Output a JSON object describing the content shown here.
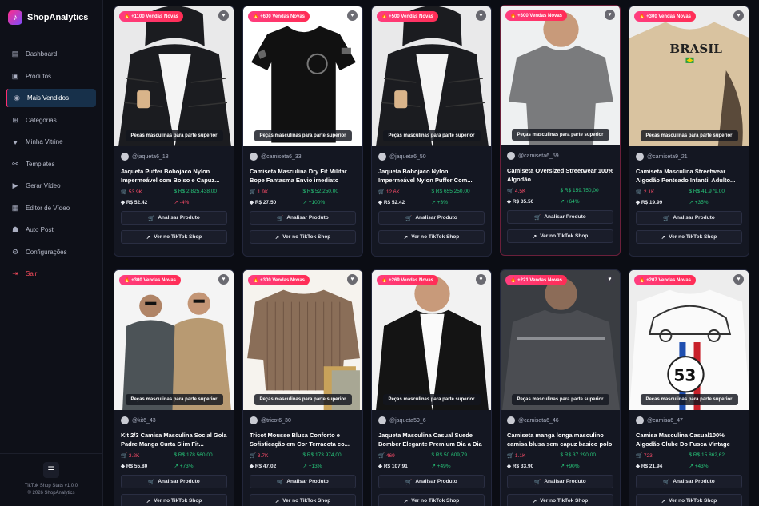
{
  "brand": {
    "name": "ShopAnalytics"
  },
  "nav": [
    {
      "label": "Dashboard",
      "icon": "chart-line-icon",
      "glyph": "▤"
    },
    {
      "label": "Produtos",
      "icon": "bag-icon",
      "glyph": "▣"
    },
    {
      "label": "Mais Vendidos",
      "icon": "flame-icon",
      "glyph": "◉"
    },
    {
      "label": "Categorias",
      "icon": "grid-icon",
      "glyph": "⊞"
    },
    {
      "label": "Minha Vitrine",
      "icon": "heart-icon",
      "glyph": "♥"
    },
    {
      "label": "Templates",
      "icon": "link-icon",
      "glyph": "⚯"
    },
    {
      "label": "Gerar Vídeo",
      "icon": "video-icon",
      "glyph": "▶"
    },
    {
      "label": "Editor de Vídeo",
      "icon": "film-icon",
      "glyph": "▦"
    },
    {
      "label": "Auto Post",
      "icon": "robot-icon",
      "glyph": "☗"
    },
    {
      "label": "Configurações",
      "icon": "gear-icon",
      "glyph": "⚙"
    },
    {
      "label": "Sair",
      "icon": "logout-icon",
      "glyph": "⇥"
    }
  ],
  "footer": {
    "version": "TikTok Shop Stats v1.0.0",
    "copyright": "© 2026 ShopAnalytics"
  },
  "card_common": {
    "category": "Peças masculinas para parte superior",
    "analyze": "Analisar Produto",
    "tiktok": "Ver no TikTok Shop"
  },
  "products": [
    {
      "badge": "🔥 +1100 Vendas Novas",
      "user": "@jaqueta6_18",
      "title": "Jaqueta Puffer Bobojaco Nylon Impermeável com Bolso e Capuz...",
      "sold": "53.9K",
      "revenue": "R$ 2.825.438,00",
      "price": "R$ 52.42",
      "growth": "-4%",
      "negative": true,
      "art": "puffer"
    },
    {
      "badge": "🔥 +600 Vendas Novas",
      "user": "@camiseta6_33",
      "title": "Camiseta Masculina Dry Fit Militar Bope Fantasma Envio imediato",
      "sold": "1.9K",
      "revenue": "R$ 52.250,00",
      "price": "R$ 27.50",
      "growth": "+100%",
      "negative": false,
      "art": "tshirt"
    },
    {
      "badge": "🔥 +500 Vendas Novas",
      "user": "@jaqueta6_50",
      "title": "Jaqueta Bobojaco Nylon Impermeável Nylon Puffer Com...",
      "sold": "12.6K",
      "revenue": "R$ 655.250,00",
      "price": "R$ 52.42",
      "growth": "+3%",
      "negative": false,
      "art": "puffer"
    },
    {
      "badge": "🔥 +300 Vendas Novas",
      "user": "@camiseta6_59",
      "title": "Camiseta Oversized Streetwear 100% Algodão",
      "sold": "4.5K",
      "revenue": "R$ 159.750,00",
      "price": "R$ 35.50",
      "growth": "+64%",
      "negative": false,
      "art": "grey-tee"
    },
    {
      "badge": "🔥 +300 Vendas Novas",
      "user": "@camiseta9_21",
      "title": "Camiseta Masculina Streetwear Algodão Penteado Infantil Adulto...",
      "sold": "2.1K",
      "revenue": "R$ 41.979,00",
      "price": "R$ 19.99",
      "growth": "+35%",
      "negative": false,
      "art": "brasil",
      "print": "BRASIL"
    },
    {
      "badge": "🔥 +300 Vendas Novas",
      "user": "@kit6_43",
      "title": "Kit 2/3 Camisa Masculina Social Gola Padre Manga Curta Slim Fit...",
      "sold": "3.2K",
      "revenue": "R$ 178.560,00",
      "price": "R$ 55.80",
      "growth": "+73%",
      "negative": false,
      "art": "twomen"
    },
    {
      "badge": "🔥 +300 Vendas Novas",
      "user": "@tricot6_30",
      "title": "Tricot Mousse Blusa Conforto e Sofisticação em Cor Terracota co...",
      "sold": "3.7K",
      "revenue": "R$ 173.974,00",
      "price": "R$ 47.02",
      "growth": "+13%",
      "negative": false,
      "art": "sweater"
    },
    {
      "badge": "🔥 +269 Vendas Novas",
      "user": "@jaqueta59_6",
      "title": "Jaqueta Masculina Casual Suede Bomber Elegante Premium Dia a Dia",
      "sold": "469",
      "revenue": "R$ 50.609,79",
      "price": "R$ 107.91",
      "growth": "+49%",
      "negative": false,
      "art": "bomber"
    },
    {
      "badge": "🔥 +221 Vendas Novas",
      "user": "@camiseta6_46",
      "title": "Camiseta manga longa masculino camisa blusa sem capuz basico polo",
      "sold": "1.1K",
      "revenue": "R$ 37.290,00",
      "price": "R$ 33.90",
      "growth": "+90%",
      "negative": false,
      "art": "longsleeve"
    },
    {
      "badge": "🔥 +207 Vendas Novas",
      "user": "@camisa6_47",
      "title": "Camisa Masculina Casual100% Algodão Clube Do Fusca Vintage",
      "sold": "723",
      "revenue": "R$ 15.862,62",
      "price": "R$ 21.94",
      "growth": "+43%",
      "negative": false,
      "art": "fusca",
      "print": "53"
    }
  ]
}
